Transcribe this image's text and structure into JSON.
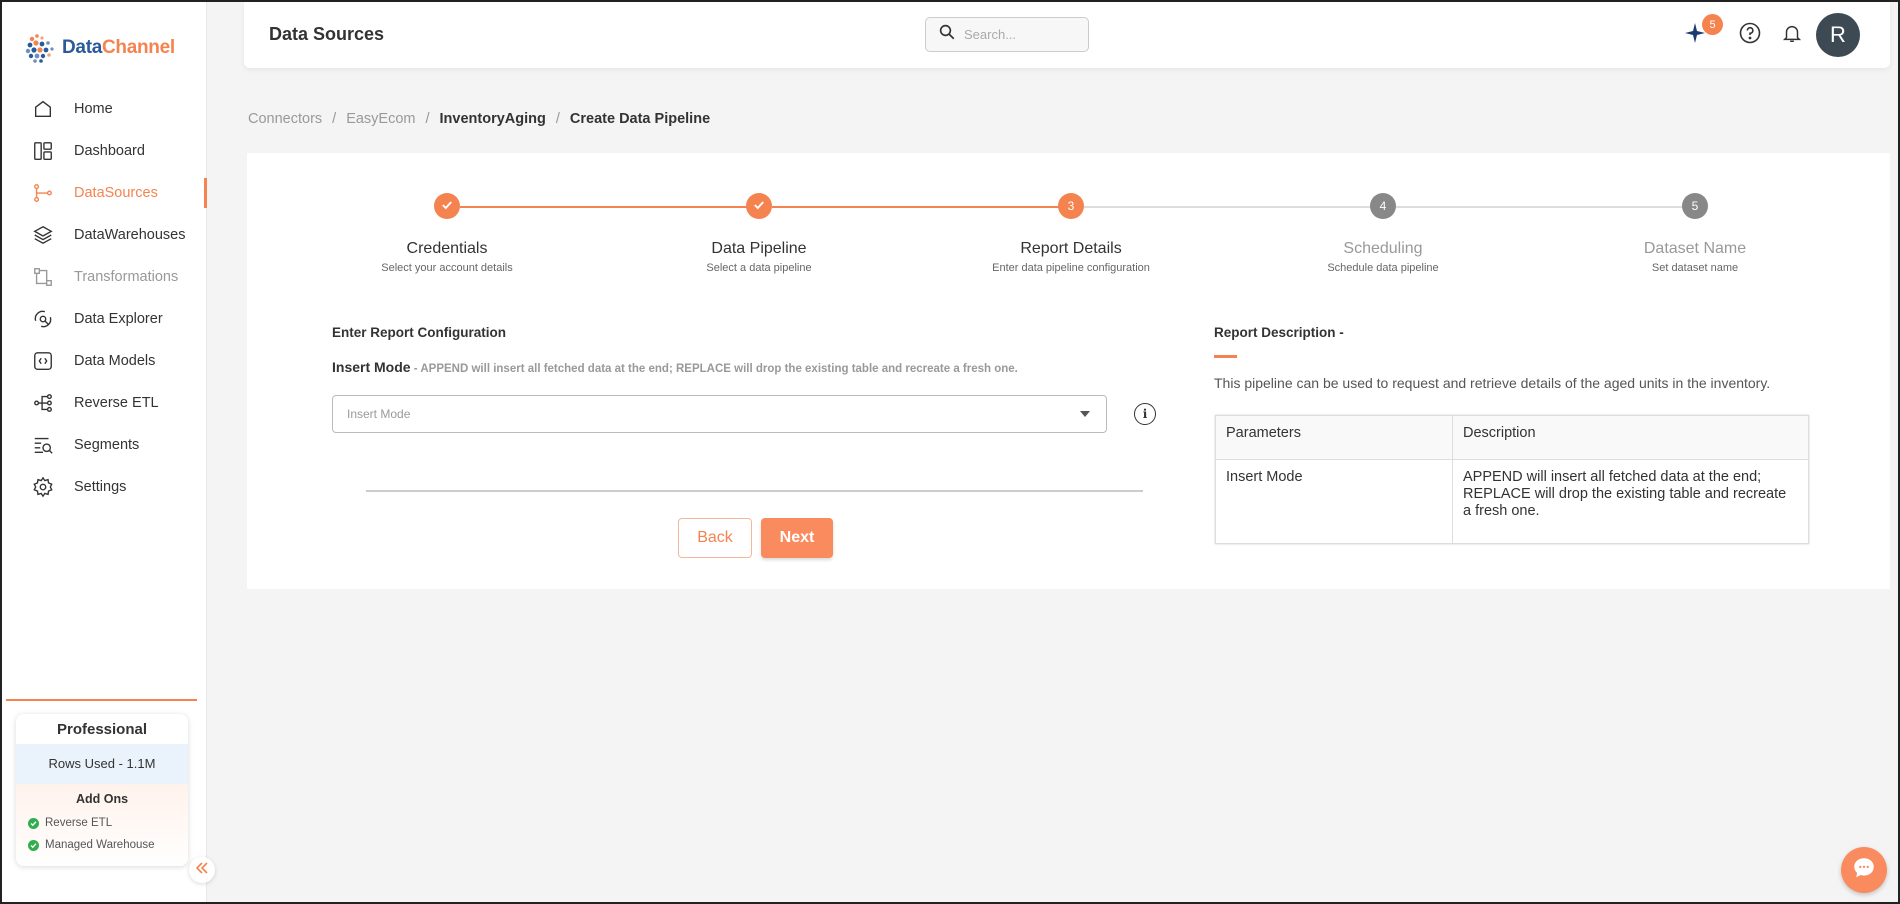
{
  "brand": {
    "name_part1": "Data",
    "name_part2": "Channel"
  },
  "colors": {
    "accent": "#f5834f",
    "accent_button": "#f98b5f",
    "avatar_bg": "#3d4a54",
    "check_green": "#2fae4d"
  },
  "sidebar": {
    "items": [
      {
        "label": "Home",
        "icon": "home-icon"
      },
      {
        "label": "Dashboard",
        "icon": "dashboard-icon"
      },
      {
        "label": "DataSources",
        "icon": "datasources-icon",
        "active": true
      },
      {
        "label": "DataWarehouses",
        "icon": "layers-icon"
      },
      {
        "label": "Transformations",
        "icon": "transformations-icon",
        "muted": true
      },
      {
        "label": "Data Explorer",
        "icon": "explorer-icon"
      },
      {
        "label": "Data Models",
        "icon": "data-models-icon"
      },
      {
        "label": "Reverse ETL",
        "icon": "reverse-etl-icon"
      },
      {
        "label": "Segments",
        "icon": "segments-icon"
      },
      {
        "label": "Settings",
        "icon": "gear-icon"
      }
    ],
    "plan": {
      "title": "Professional",
      "rows_used": "Rows Used - 1.1M",
      "addons_title": "Add Ons",
      "addons": [
        "Reverse ETL",
        "Managed Warehouse"
      ]
    }
  },
  "header": {
    "title": "Data Sources",
    "search_placeholder": "Search...",
    "notification_count": "5",
    "avatar_initial": "R"
  },
  "breadcrumb": {
    "items": [
      "Connectors",
      "EasyEcom",
      "InventoryAging",
      "Create Data Pipeline"
    ],
    "separator": "/"
  },
  "stepper": {
    "steps": [
      {
        "number": "1",
        "label": "Credentials",
        "sub": "Select your account details",
        "state": "done"
      },
      {
        "number": "2",
        "label": "Data Pipeline",
        "sub": "Select a data pipeline",
        "state": "done"
      },
      {
        "number": "3",
        "label": "Report Details",
        "sub": "Enter data pipeline configuration",
        "state": "current"
      },
      {
        "number": "4",
        "label": "Scheduling",
        "sub": "Schedule data pipeline",
        "state": "pending"
      },
      {
        "number": "5",
        "label": "Dataset Name",
        "sub": "Set dataset name",
        "state": "pending"
      }
    ]
  },
  "form": {
    "section_title": "Enter Report Configuration",
    "insert_mode_label": "Insert Mode",
    "insert_mode_hint": " - APPEND will insert all fetched data at the end; REPLACE will drop the existing table and recreate a fresh one.",
    "insert_mode_placeholder": "Insert Mode",
    "back_label": "Back",
    "next_label": "Next"
  },
  "description": {
    "title": "Report Description -",
    "text": "This pipeline can be used to request and retrieve details of the aged units in the inventory.",
    "table": {
      "headers": [
        "Parameters",
        "Description"
      ],
      "rows": [
        [
          "Insert Mode",
          "APPEND will insert all fetched data at the end; REPLACE will drop the existing table and recreate a fresh one."
        ]
      ]
    }
  }
}
